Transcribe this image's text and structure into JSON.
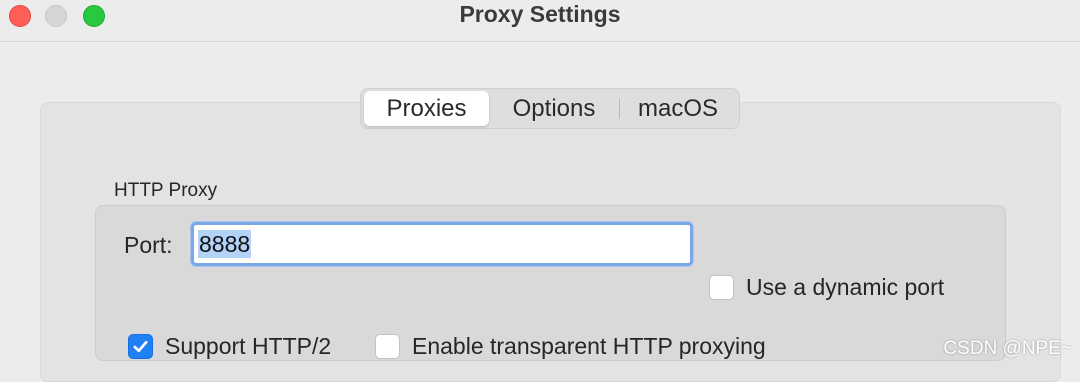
{
  "window": {
    "title": "Proxy Settings",
    "traffic_lights": {
      "close_color": "#fe5f57",
      "minimize_color": "#d6d6d6",
      "zoom_color": "#28c840"
    }
  },
  "tabs": [
    {
      "label": "Proxies",
      "selected": true
    },
    {
      "label": "Options",
      "selected": false
    },
    {
      "label": "macOS",
      "selected": false
    }
  ],
  "http_proxy": {
    "section_label": "HTTP Proxy",
    "port_label": "Port:",
    "port_value": "8888",
    "dynamic_port": {
      "label": "Use a dynamic port",
      "checked": false
    },
    "support_http2": {
      "label": "Support HTTP/2",
      "checked": true
    },
    "transparent_proxying": {
      "label": "Enable transparent HTTP proxying",
      "checked": false
    }
  },
  "colors": {
    "accent": "#1f7ff5",
    "focus_ring": "#7aa8e6"
  },
  "watermark": "CSDN @NPE~"
}
